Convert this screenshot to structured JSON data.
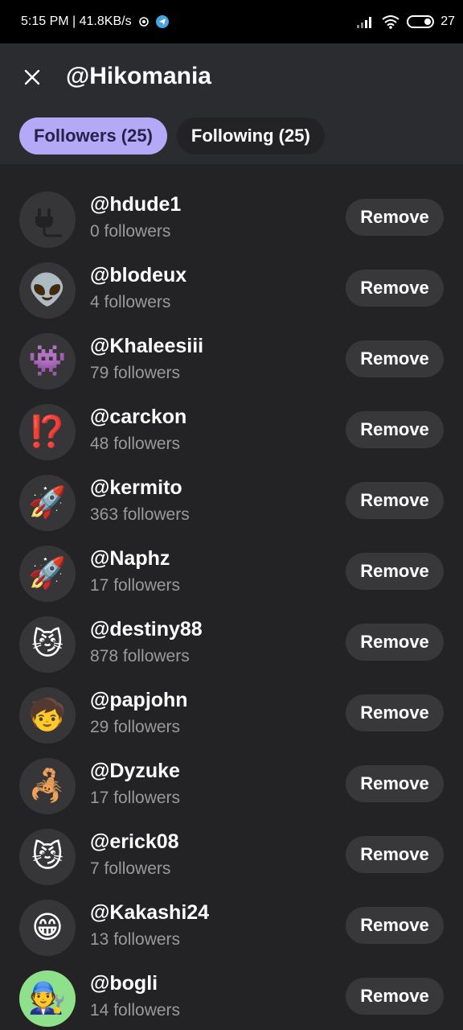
{
  "status_bar": {
    "time_speed": "5:15 PM | 41.8KB/s",
    "battery": "27"
  },
  "header": {
    "title": "@Hikomania",
    "tabs": [
      {
        "label": "Followers (25)",
        "active": true
      },
      {
        "label": "Following (25)",
        "active": false
      }
    ]
  },
  "followers": [
    {
      "username": "@hdude1",
      "followers": "0 followers",
      "avatar": "plug-icon",
      "remove_label": "Remove"
    },
    {
      "username": "@blodeux",
      "followers": "4 followers",
      "avatar": "👽",
      "remove_label": "Remove"
    },
    {
      "username": "@Khaleesiii",
      "followers": "79 followers",
      "avatar": "👾",
      "remove_label": "Remove"
    },
    {
      "username": "@carckon",
      "followers": "48 followers",
      "avatar": "⁉️",
      "remove_label": "Remove"
    },
    {
      "username": "@kermito",
      "followers": "363 followers",
      "avatar": "🚀",
      "remove_label": "Remove"
    },
    {
      "username": "@Naphz",
      "followers": "17 followers",
      "avatar": "🚀",
      "remove_label": "Remove"
    },
    {
      "username": "@destiny88",
      "followers": "878 followers",
      "avatar": "😼",
      "remove_label": "Remove"
    },
    {
      "username": "@papjohn",
      "followers": "29 followers",
      "avatar": "🧒",
      "remove_label": "Remove"
    },
    {
      "username": "@Dyzuke",
      "followers": "17 followers",
      "avatar": "🦂",
      "remove_label": "Remove"
    },
    {
      "username": "@erick08",
      "followers": "7 followers",
      "avatar": "😼",
      "remove_label": "Remove"
    },
    {
      "username": "@Kakashi24",
      "followers": "13 followers",
      "avatar": "😁",
      "remove_label": "Remove"
    },
    {
      "username": "@bogli",
      "followers": "14 followers",
      "avatar": "🧑‍🔧",
      "remove_label": "Remove"
    }
  ]
}
